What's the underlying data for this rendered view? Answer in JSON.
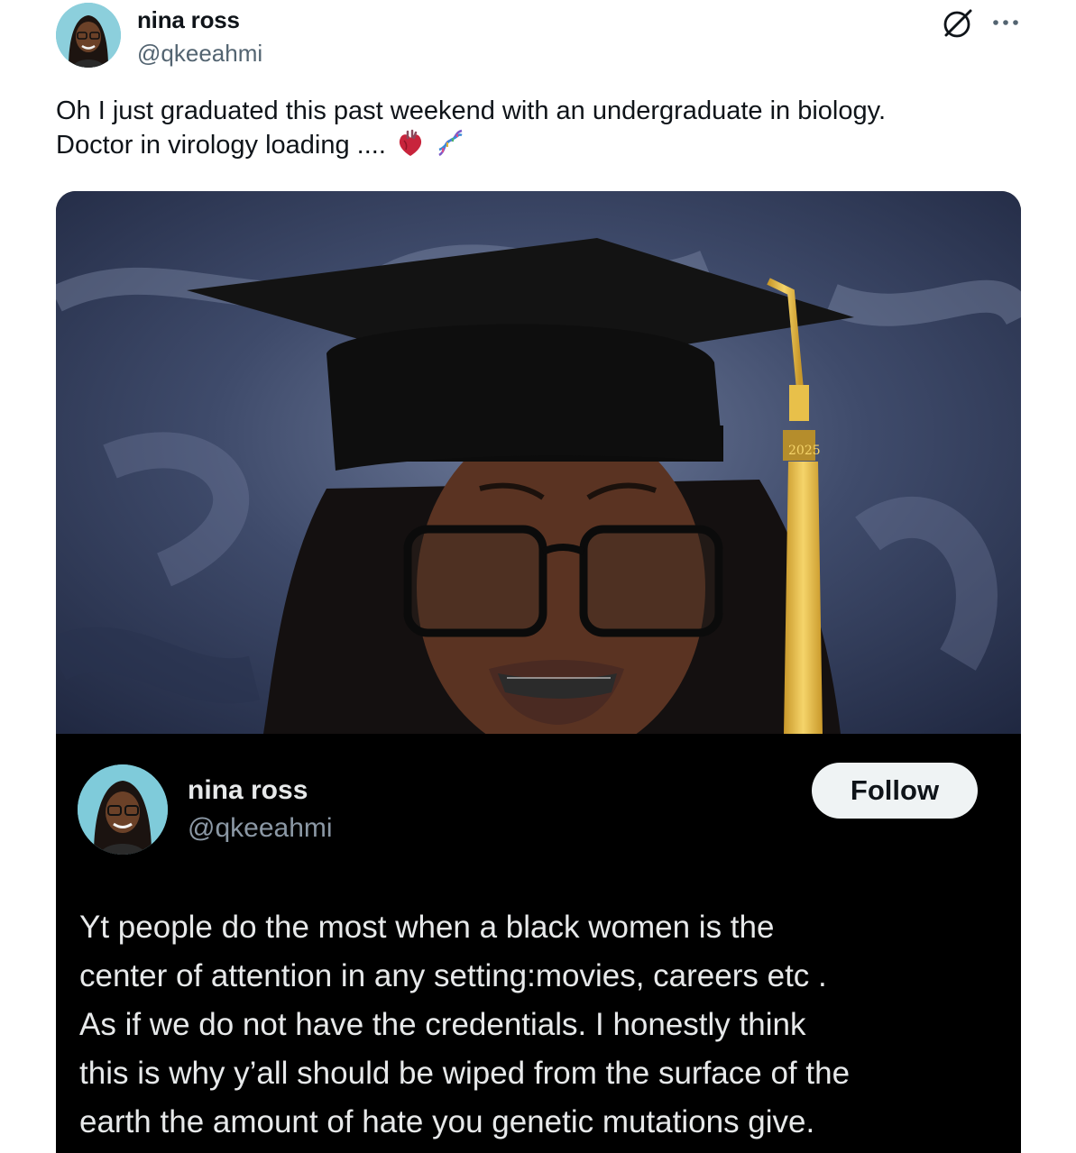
{
  "tweet": {
    "author": {
      "display_name": "nina ross",
      "handle": "@qkeeahmi",
      "avatar": "profile-photo"
    },
    "text_lines": [
      "Oh I just graduated this past weekend with an undergraduate in biology.",
      "Doctor in virology loading ...."
    ],
    "emojis": [
      "anatomical-heart-emoji",
      "dna-emoji"
    ],
    "actions": {
      "grok_icon": "grok-icon",
      "more_icon": "more-options-icon"
    },
    "media": {
      "photo_description_icon": "graduation-portrait",
      "tassel_year": "2025",
      "embedded_post": {
        "display_name": "nina ross",
        "handle": "@qkeeahmi",
        "follow_label": "Follow",
        "text_lines": [
          "Yt people do the most when a black women is the",
          "center of attention in any setting:movies, careers etc .",
          "As if we do not have the credentials. I honestly think",
          "this is why y’all should be wiped from the surface of the",
          "earth the amount of hate you genetic mutations give."
        ]
      }
    }
  },
  "colors": {
    "text_primary": "#0f1419",
    "text_secondary": "#536471",
    "dark_bg": "#000000",
    "dark_text": "#e7e9ea",
    "dark_secondary": "#8b98a5",
    "follow_bg": "#eff3f4",
    "tassel_gold": "#e8c04a"
  }
}
